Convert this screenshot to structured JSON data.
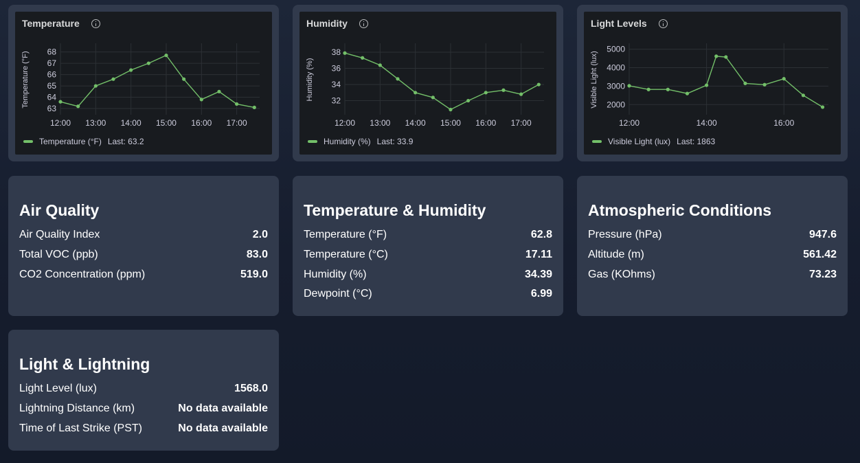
{
  "charts": [
    {
      "title": "Temperature",
      "ylabel": "Temperature (°F)",
      "legend": "Temperature (°F)",
      "last": "Last: 63.2",
      "chart_data": {
        "type": "line",
        "title": "Temperature",
        "ylabel": "Temperature (°F)",
        "xlabel": "",
        "x": [
          "12:00",
          "12:30",
          "13:00",
          "13:30",
          "14:00",
          "14:30",
          "15:00",
          "15:30",
          "16:00",
          "16:30",
          "17:00",
          "17:30"
        ],
        "xticks": [
          "12:00",
          "13:00",
          "14:00",
          "15:00",
          "16:00",
          "17:00"
        ],
        "yticks": [
          63,
          64,
          65,
          66,
          67,
          68
        ],
        "ylim": [
          62.7,
          68.4
        ],
        "series": [
          {
            "name": "Temperature (°F)",
            "values": [
              63.6,
              63.2,
              65.0,
              65.6,
              66.4,
              67.0,
              67.7,
              65.6,
              63.8,
              64.5,
              63.4,
              63.1
            ]
          }
        ],
        "color": "#73bf69",
        "grid": true,
        "legend_position": "bottom-left"
      }
    },
    {
      "title": "Humidity",
      "ylabel": "Humidity (%)",
      "legend": "Humidity (%)",
      "last": "Last: 33.9",
      "chart_data": {
        "type": "line",
        "title": "Humidity",
        "ylabel": "Humidity (%)",
        "xlabel": "",
        "x": [
          "12:00",
          "12:30",
          "13:00",
          "13:30",
          "14:00",
          "14:30",
          "15:00",
          "15:30",
          "16:00",
          "16:30",
          "17:00",
          "17:30"
        ],
        "xticks": [
          "12:00",
          "13:00",
          "14:00",
          "15:00",
          "16:00",
          "17:00"
        ],
        "yticks": [
          32,
          34,
          36,
          38
        ],
        "ylim": [
          30.6,
          38.6
        ],
        "series": [
          {
            "name": "Humidity (%)",
            "values": [
              37.9,
              37.3,
              36.4,
              34.7,
              33.0,
              32.4,
              30.9,
              32.0,
              33.0,
              33.3,
              32.8,
              34.0
            ]
          }
        ],
        "color": "#73bf69",
        "grid": true,
        "legend_position": "bottom-left"
      }
    },
    {
      "title": "Light Levels",
      "ylabel": "Visible Light (lux)",
      "legend": "Visible Light (lux)",
      "last": "Last: 1863",
      "chart_data": {
        "type": "line",
        "title": "Light Levels",
        "ylabel": "Visible Light (lux)",
        "xlabel": "",
        "x": [
          "12:00",
          "12:30",
          "13:00",
          "13:30",
          "14:00",
          "14:15",
          "14:30",
          "15:00",
          "15:30",
          "16:00",
          "16:30",
          "17:00"
        ],
        "xvals": [
          0,
          0.5,
          1.0,
          1.5,
          2.0,
          2.25,
          2.5,
          3.0,
          3.5,
          4.0,
          4.5,
          5.0
        ],
        "xticks": [
          "12:00",
          "14:00",
          "16:00"
        ],
        "yticks": [
          2000,
          3000,
          4000,
          5000
        ],
        "ylim": [
          1600,
          5100
        ],
        "series": [
          {
            "name": "Visible Light (lux)",
            "values": [
              3020,
              2820,
              2820,
              2600,
              3050,
              4620,
              4580,
              3150,
              3080,
              3400,
              2500,
              1863
            ]
          }
        ],
        "color": "#73bf69",
        "grid": true,
        "legend_position": "bottom-left"
      }
    }
  ],
  "panels": [
    {
      "title": "Air Quality",
      "rows": [
        {
          "label": "Air Quality Index",
          "value": "2.0"
        },
        {
          "label": "Total VOC (ppb)",
          "value": "83.0"
        },
        {
          "label": "CO2 Concentration (ppm)",
          "value": "519.0"
        }
      ]
    },
    {
      "title": "Temperature & Humidity",
      "rows": [
        {
          "label": "Temperature (°F)",
          "value": "62.8"
        },
        {
          "label": "Temperature (°C)",
          "value": "17.11"
        },
        {
          "label": "Humidity (%)",
          "value": "34.39"
        },
        {
          "label": "Dewpoint (°C)",
          "value": "6.99"
        }
      ]
    },
    {
      "title": "Atmospheric Conditions",
      "rows": [
        {
          "label": "Pressure (hPa)",
          "value": "947.6"
        },
        {
          "label": "Altitude (m)",
          "value": "561.42"
        },
        {
          "label": "Gas (KOhms)",
          "value": "73.23"
        }
      ]
    },
    {
      "title": "Light & Lightning",
      "rows": [
        {
          "label": "Light Level (lux)",
          "value": "1568.0"
        },
        {
          "label": "Lightning Distance (km)",
          "value": "No data available"
        },
        {
          "label": "Time of Last Strike (PST)",
          "value": "No data available"
        }
      ]
    }
  ],
  "icons": {
    "info": "info-circle-icon"
  },
  "colors": {
    "series": "#73bf69",
    "panel_bg": "#181b1f",
    "card_bg": "#313a4c"
  }
}
